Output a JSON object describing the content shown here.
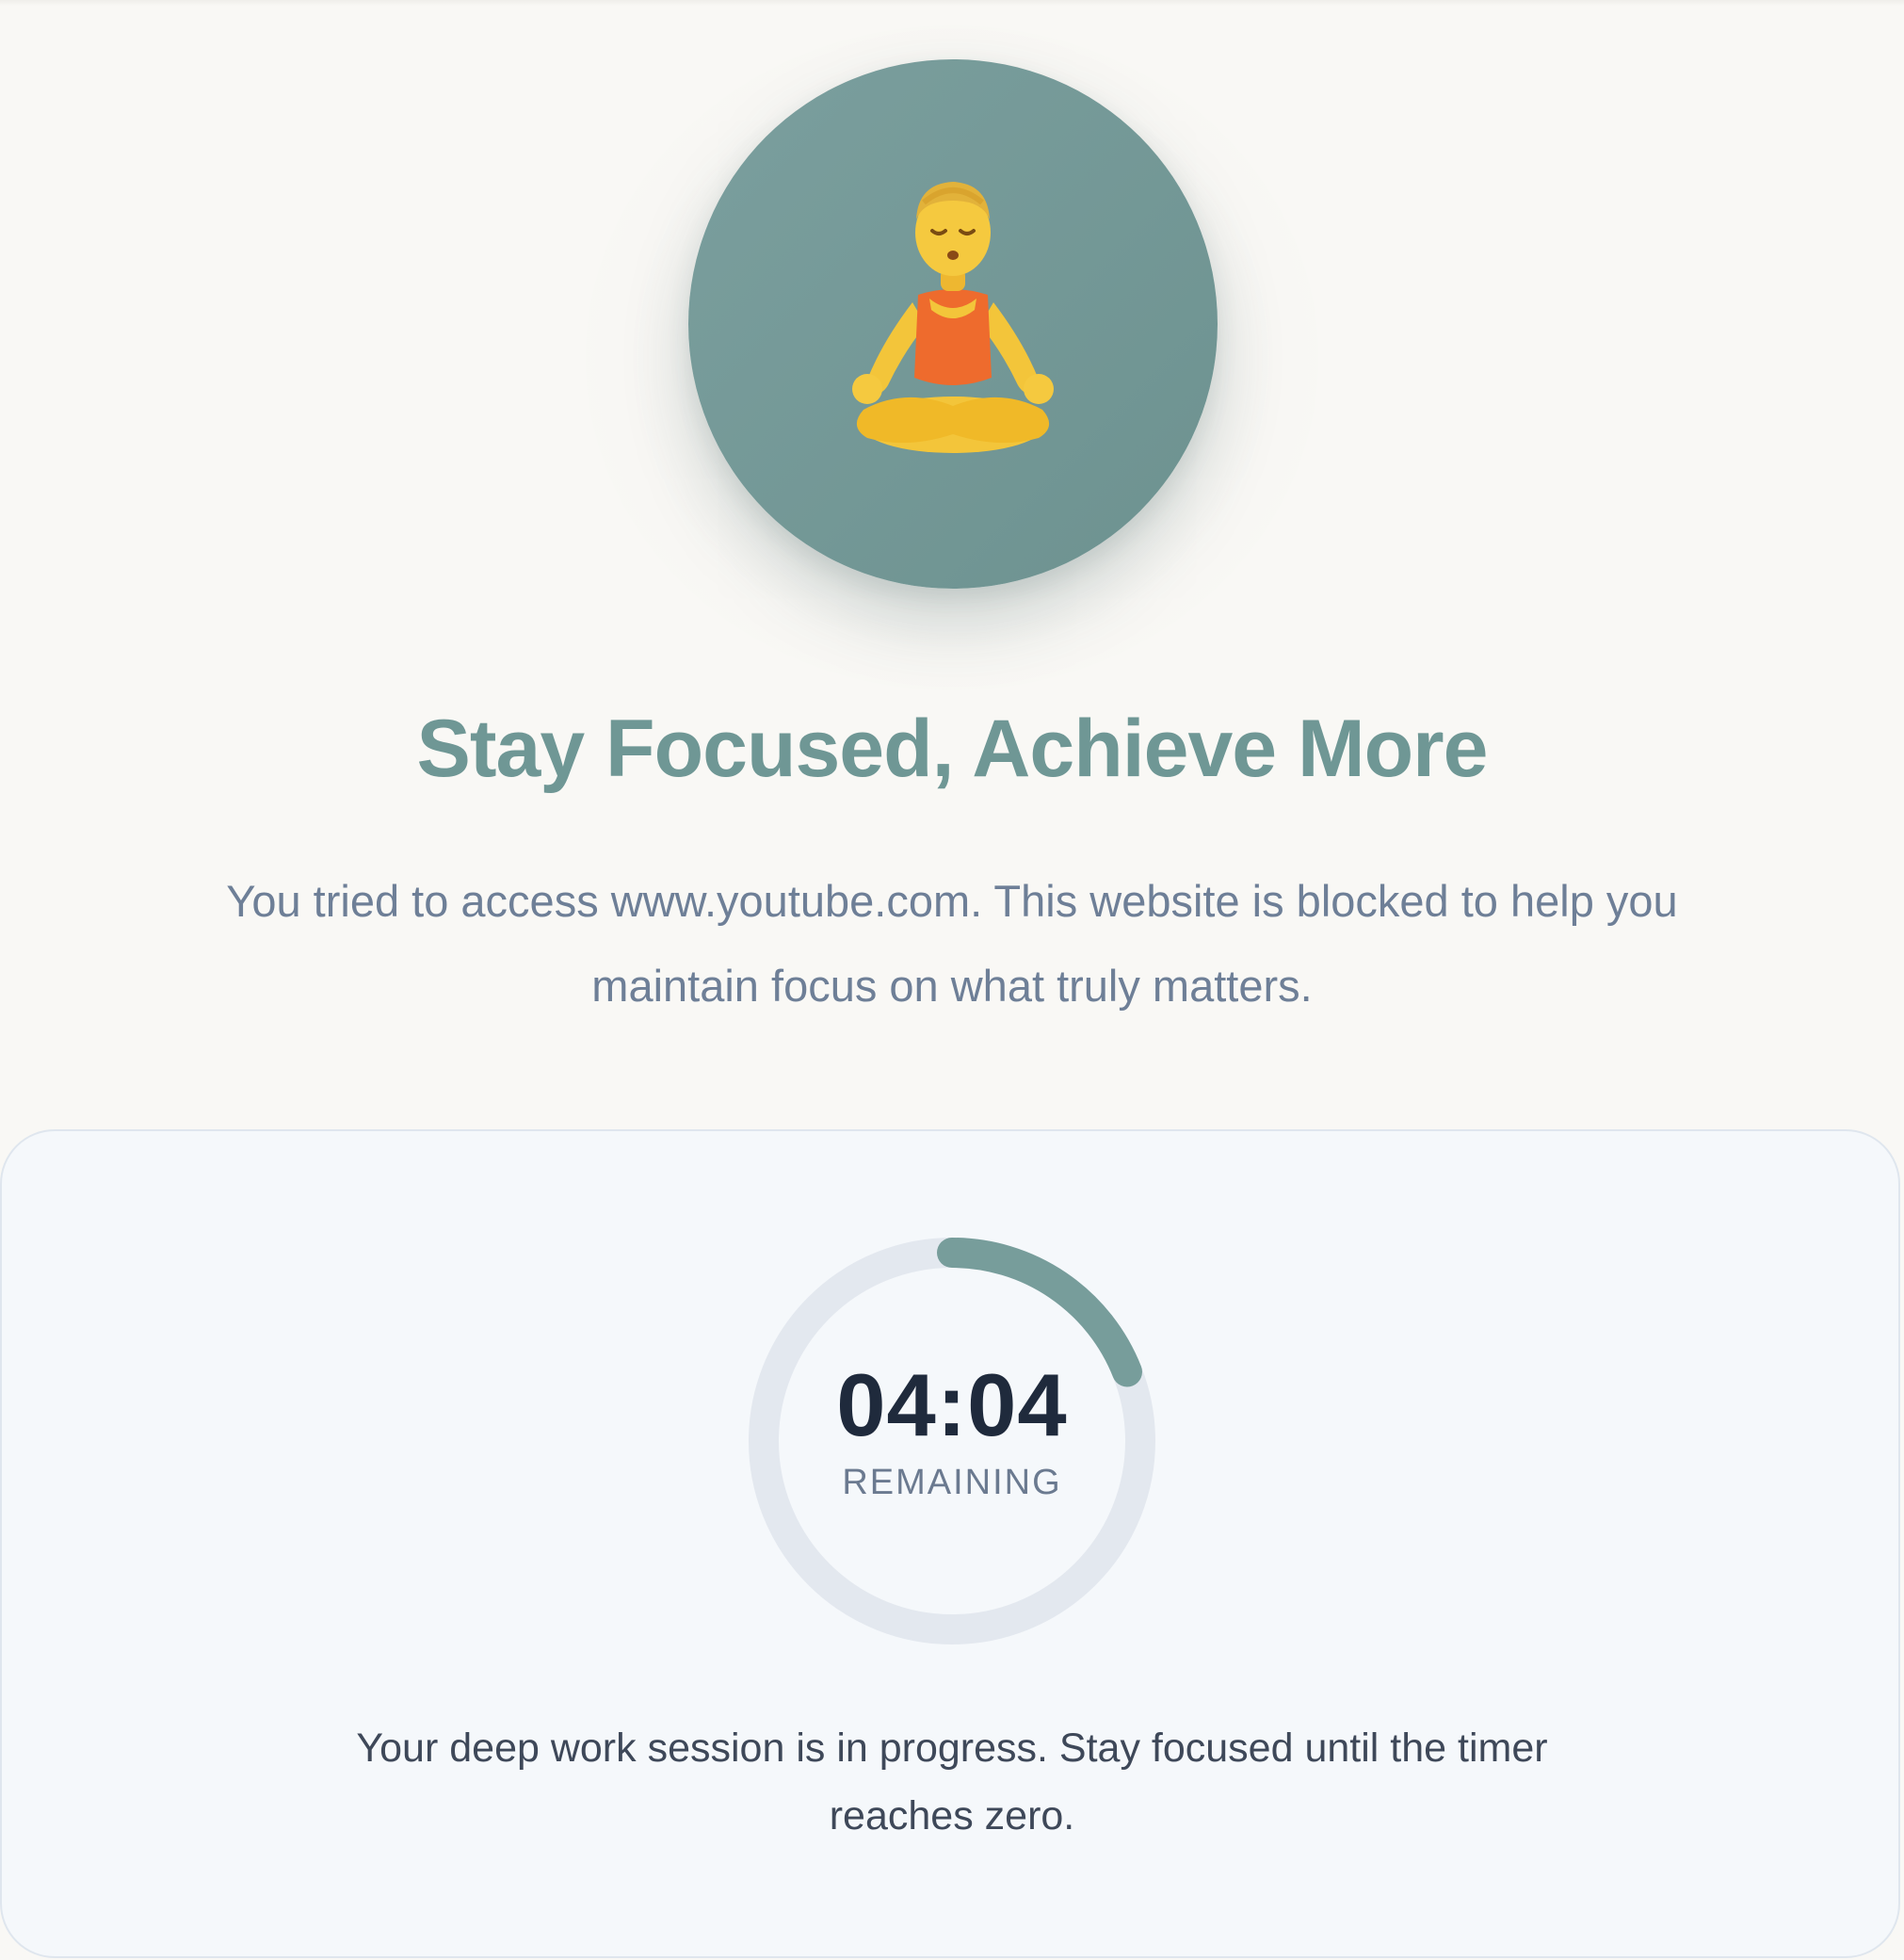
{
  "hero": {
    "icon": "meditation-person-icon",
    "title": "Stay Focused, Achieve More",
    "message": "You tried to access www.youtube.com. This website is blocked to help you maintain focus on what truly matters."
  },
  "timer": {
    "time_remaining": "04:04",
    "label": "REMAINING",
    "progress_fraction": 0.19,
    "track_color": "#e3e8ef",
    "progress_color": "#779d9b"
  },
  "session": {
    "message": "Your deep work session is in progress. Stay focused until the timer reaches zero."
  },
  "colors": {
    "accent": "#6f9795",
    "background": "#f9f8f5",
    "card_background": "#f5f8fb"
  }
}
